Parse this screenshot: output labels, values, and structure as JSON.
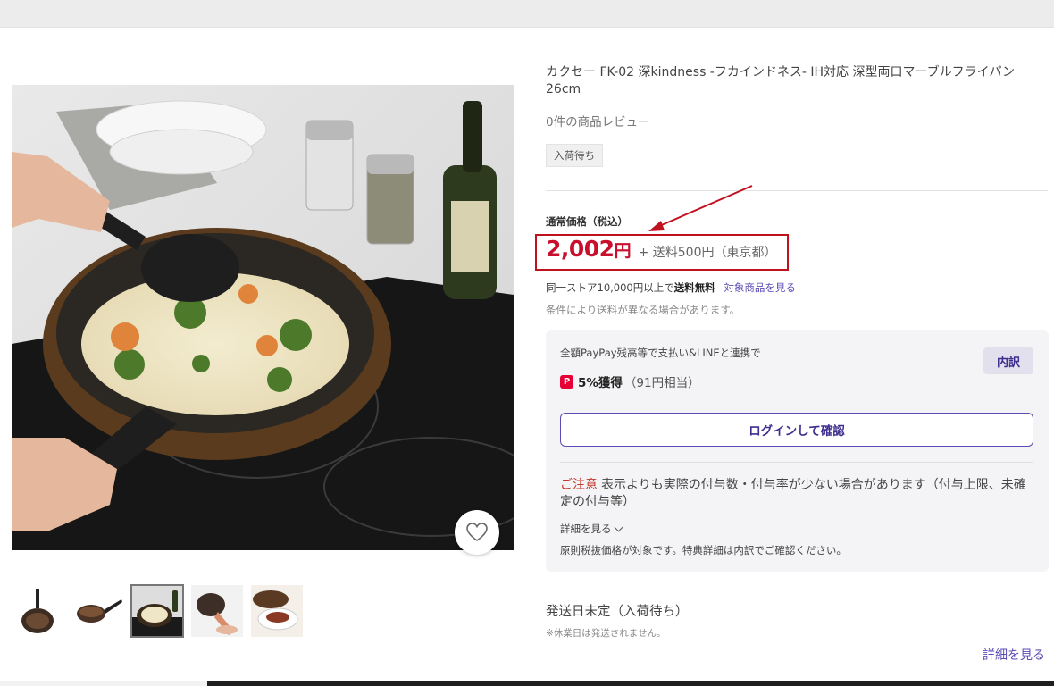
{
  "product": {
    "title": "カクセー FK-02 深kindness -フカインドネス- IH対応 深型両口マーブルフライパン 26cm",
    "review_count": "0件の商品レビュー",
    "stock_status": "入荷待ち"
  },
  "price": {
    "label": "通常価格（税込）",
    "value": "2,002",
    "currency": "円",
    "shipping": "+ 送料500円（東京都）"
  },
  "shipping_info": {
    "free_ship_prefix": "同一ストア10,000円以上で",
    "free_ship_bold": "送料無料",
    "free_ship_link": "対象商品を見る",
    "note": "条件により送料が異なる場合があります。"
  },
  "points": {
    "heading": "全額PayPay残高等で支払い&LINEと連携で",
    "breakdown_label": "内訳",
    "icon_glyph": "P",
    "reward_bold": "5%獲得",
    "reward_sub": "（91円相当）",
    "login_button": "ログインして確認",
    "caution_label": "ご注意",
    "caution_text": "表示よりも実際の付与数・付与率が少ない場合があります（付与上限、未確定の付与等）",
    "details_toggle": "詳細を見る",
    "footnote": "原則税抜価格が対象です。特典詳細は内訳でご確認ください。"
  },
  "delivery": {
    "ship_date": "発送日未定（入荷待ち）",
    "holiday_note": "※休業日は発送されません。",
    "details_link": "詳細を見る"
  },
  "gallery": {
    "selected_thumbnail": 3,
    "thumbnail_count": 5
  },
  "colors": {
    "price_red": "#c8102e",
    "accent_purple": "#5b4cb5",
    "highlight_box": "#c0111f",
    "paypay_red": "#e60033"
  }
}
